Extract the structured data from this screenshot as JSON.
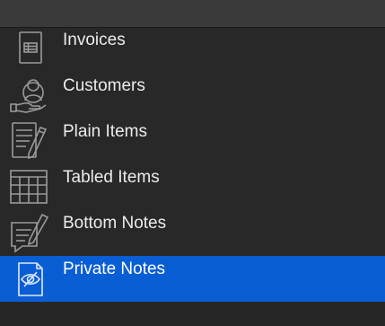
{
  "sidebar": {
    "items": [
      {
        "label": "Invoices",
        "icon": "invoice-icon",
        "selected": false
      },
      {
        "label": "Customers",
        "icon": "customer-hand-icon",
        "selected": false
      },
      {
        "label": "Plain Items",
        "icon": "document-pen-icon",
        "selected": false
      },
      {
        "label": "Tabled Items",
        "icon": "table-grid-icon",
        "selected": false
      },
      {
        "label": "Bottom Notes",
        "icon": "speech-note-pen-icon",
        "selected": false
      },
      {
        "label": "Private Notes",
        "icon": "eye-hidden-note-icon",
        "selected": true
      }
    ]
  },
  "colors": {
    "background": "#282828",
    "selection": "#0a5ed4",
    "text": "#ececec",
    "icon_stroke": "#9a9a9a"
  }
}
